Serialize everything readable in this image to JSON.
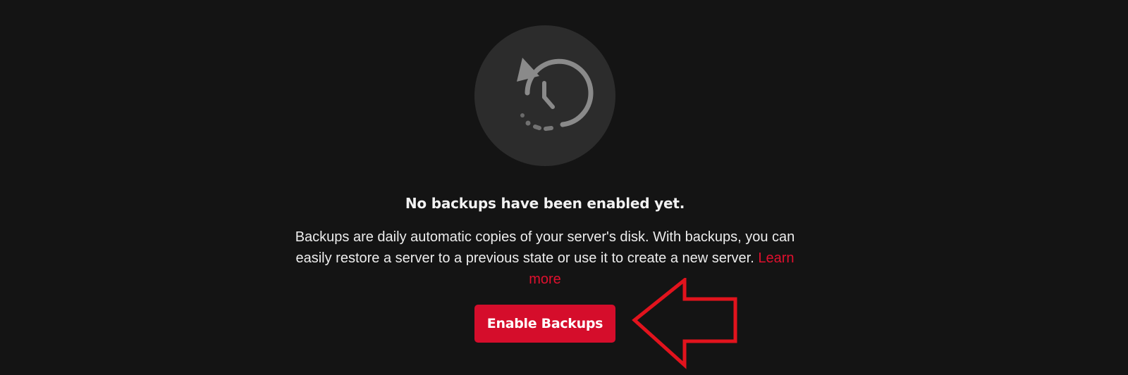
{
  "empty_state": {
    "icon": "backup-restore-clock-icon",
    "title": "No backups have been enabled yet.",
    "description": "Backups are daily automatic copies of your server's disk. With backups, you can easily restore a server to a previous state or use it to create a new server.",
    "learn_more_label": "Learn more",
    "button_label": "Enable Backups"
  },
  "annotation": {
    "icon": "left-arrow-outline-annotation",
    "color": "#e2131d"
  },
  "colors": {
    "background": "#141414",
    "icon_circle": "#2c2c2c",
    "icon_stroke": "#8a8a8a",
    "accent": "#d50d2b",
    "link": "#e0102e",
    "text": "#ededed"
  }
}
